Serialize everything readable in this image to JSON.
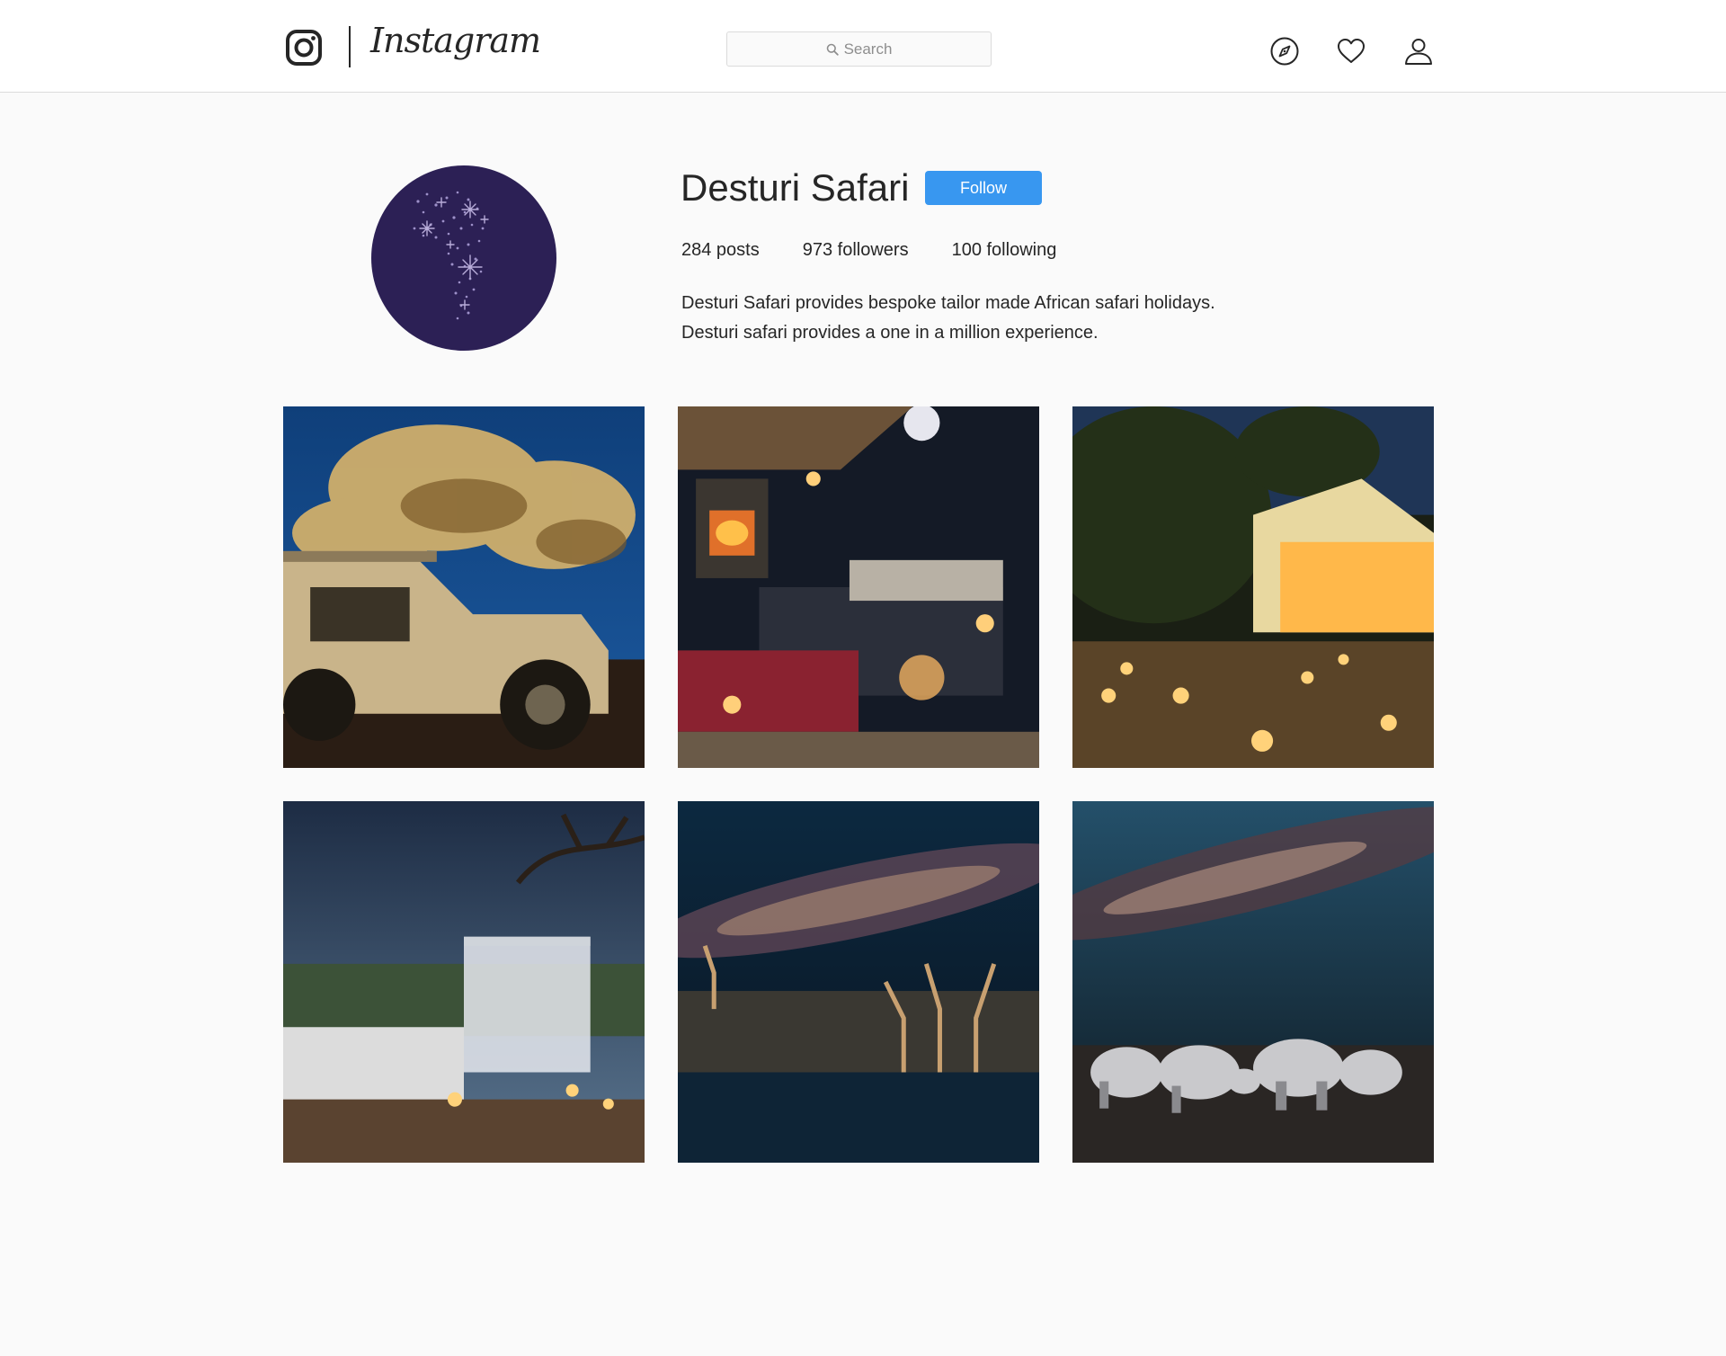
{
  "app": {
    "name": "Instagram"
  },
  "search": {
    "placeholder": "Search"
  },
  "nav": {
    "explore_icon": "compass-icon",
    "activity_icon": "heart-icon",
    "profile_icon": "user-icon"
  },
  "profile": {
    "username": "Desturi Safari",
    "follow_label": "Follow",
    "stats": {
      "posts": "284 posts",
      "followers": "973 followers",
      "following": "100 following"
    },
    "bio": [
      "Desturi Safari provides bespoke tailor made African safari holidays.",
      "Desturi safari provides a one in a million experience."
    ]
  },
  "colors": {
    "accent": "#3897f0",
    "avatar_bg": "#2c2055",
    "page_bg": "#fafafa",
    "text": "#262626"
  }
}
